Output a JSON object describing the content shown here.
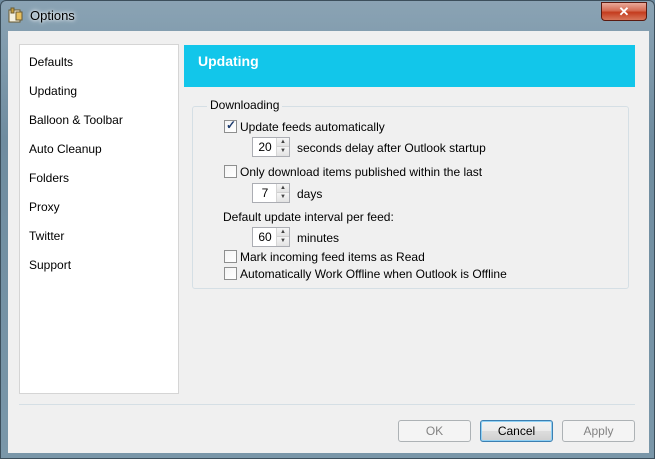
{
  "window": {
    "title": "Options",
    "close_label": "✕"
  },
  "sidebar": {
    "items": [
      {
        "label": "Defaults"
      },
      {
        "label": "Updating"
      },
      {
        "label": "Balloon & Toolbar"
      },
      {
        "label": "Auto Cleanup"
      },
      {
        "label": "Folders"
      },
      {
        "label": "Proxy"
      },
      {
        "label": "Twitter"
      },
      {
        "label": "Support"
      }
    ]
  },
  "main": {
    "header_title": "Updating",
    "header_color": "#12c6ea",
    "group": {
      "legend": "Downloading",
      "update_auto": {
        "label": "Update feeds automatically",
        "checked": true
      },
      "startup_delay": {
        "value": "20",
        "suffix": "seconds delay after Outlook startup"
      },
      "only_recent": {
        "label": "Only download items published within the last",
        "checked": false
      },
      "recent_days": {
        "value": "7",
        "suffix": "days"
      },
      "interval_label": "Default update interval per feed:",
      "interval": {
        "value": "60",
        "suffix": "minutes"
      },
      "mark_read": {
        "label": "Mark incoming feed items as Read",
        "checked": false
      },
      "work_offline": {
        "label": "Automatically Work Offline when Outlook is Offline",
        "checked": false
      }
    }
  },
  "buttons": {
    "ok": "OK",
    "cancel": "Cancel",
    "apply": "Apply"
  }
}
